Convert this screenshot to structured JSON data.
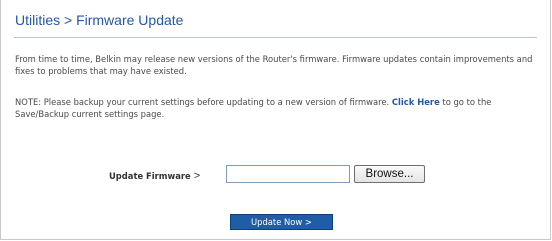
{
  "page": {
    "title": "Utilities > Firmware Update",
    "intro": "From time to time, Belkin may release new versions of the Router's firmware. Firmware updates contain improvements and fixes to problems that may have existed.",
    "note_prefix": "NOTE: Please backup your current settings before updating to a new version of firmware.",
    "note_link": "Click Here",
    "note_suffix": "to go to the Save/Backup current settings page."
  },
  "upload": {
    "label": "Update Firmware",
    "separator": ">",
    "file_value": "",
    "browse_label": "Browse..."
  },
  "actions": {
    "update_now_label": "Update Now >"
  },
  "colors": {
    "title": "#2458a8",
    "link": "#2458a8",
    "button_bg": "#1f5ea6"
  }
}
